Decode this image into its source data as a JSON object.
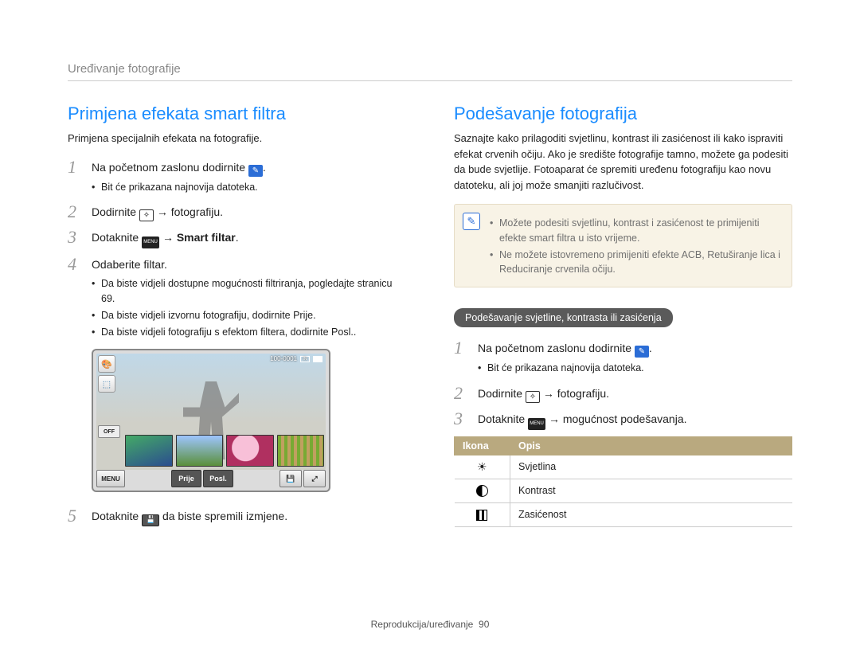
{
  "header": {
    "title": "Uređivanje fotografije"
  },
  "left": {
    "heading": "Primjena efekata smart filtra",
    "intro": "Primjena specijalnih efekata na fotografije.",
    "steps": [
      {
        "num": "1",
        "text_a": "Na početnom zaslonu dodirnite ",
        "bullets": [
          "Bit će prikazana najnovija datoteka."
        ]
      },
      {
        "num": "2",
        "text_a": "Dodirnite ",
        "text_b": " → fotografiju."
      },
      {
        "num": "3",
        "text_a": "Dotaknite ",
        "text_b": " → ",
        "bold_c": "Smart filtar",
        "text_d": "."
      },
      {
        "num": "4",
        "text_a": "Odaberite filtar.",
        "bullets": [
          "Da biste vidjeli dostupne mogućnosti filtriranja, pogledajte stranicu 69.",
          "Da biste vidjeli izvornu fotografiju, dodirnite Prije.",
          "Da biste vidjeli fotografiju s efektom filtera, dodirnite Posl.."
        ]
      },
      {
        "num": "5",
        "text_a": "Dotaknite ",
        "text_b": " da biste spremili izmjene."
      }
    ],
    "screen": {
      "counter": "100-0001",
      "off": "OFF",
      "menu": "MENU",
      "before": "Prije",
      "after": "Posl."
    }
  },
  "right": {
    "heading": "Podešavanje fotografija",
    "intro": "Saznajte kako prilagoditi svjetlinu, kontrast ili zasićenost ili kako ispraviti efekat crvenih očiju. Ako je središte fotografije tamno, možete ga podesiti da bude svjetlije. Fotoaparat će spremiti uređenu fotografiju kao novu datoteku, ali joj može smanjiti razlučivost.",
    "info": [
      "Možete podesiti svjetlinu, kontrast i zasićenost te primijeniti efekte smart filtra u isto vrijeme.",
      "Ne možete istovremeno primijeniti efekte ACB, Retuširanje lica i Reduciranje crvenila očiju."
    ],
    "pill": "Podešavanje svjetline, kontrasta ili zasićenja",
    "steps": [
      {
        "num": "1",
        "text_a": "Na početnom zaslonu dodirnite ",
        "bullets": [
          "Bit će prikazana najnovija datoteka."
        ]
      },
      {
        "num": "2",
        "text_a": "Dodirnite ",
        "text_b": " → fotografiju."
      },
      {
        "num": "3",
        "text_a": "Dotaknite ",
        "text_b": " → mogućnost podešavanja."
      }
    ],
    "table": {
      "head": [
        "Ikona",
        "Opis"
      ],
      "rows": [
        {
          "label": "Svjetlina"
        },
        {
          "label": "Kontrast"
        },
        {
          "label": "Zasićenost"
        }
      ]
    }
  },
  "footer": {
    "text": "Reprodukcija/uređivanje",
    "page": "90"
  }
}
